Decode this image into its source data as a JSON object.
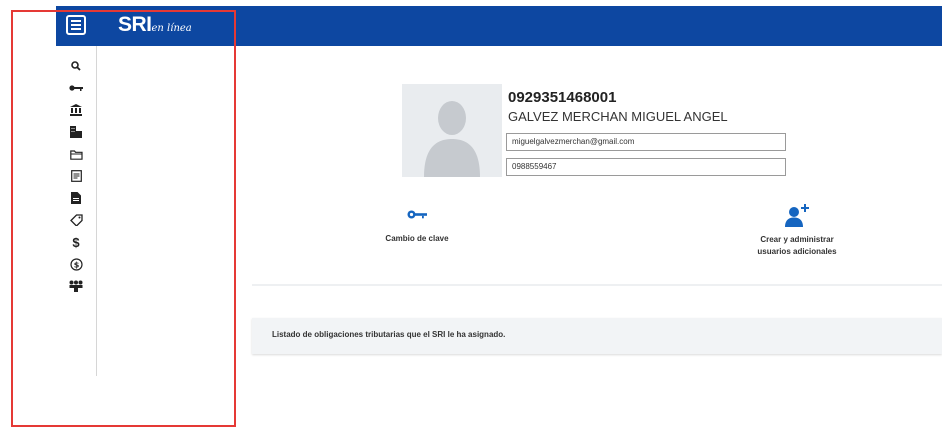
{
  "header": {
    "logo_main": "SRI",
    "logo_script": "en línea",
    "bg_color": "#0d47a1"
  },
  "sidebar": {
    "icons": [
      "search-icon",
      "key-icon",
      "bank-icon",
      "building-icon",
      "folder-icon",
      "document-list-icon",
      "document-icon",
      "tag-icon",
      "dollar-icon",
      "dollar-circle-icon",
      "group-icon"
    ],
    "dollar_glyph": "$"
  },
  "profile": {
    "id": "0929351468001",
    "name": "GALVEZ MERCHAN MIGUEL ANGEL",
    "email": "miguelgalvezmerchan@gmail.com",
    "phone": "0988559467"
  },
  "actions": {
    "change_password": "Cambio de clave",
    "manage_users_line1": "Crear y administrar",
    "manage_users_line2": "usuarios adicionales"
  },
  "obligations": {
    "text": "Listado de obligaciones tributarias que el SRI le ha asignado."
  },
  "annotation": {
    "color": "#e53935"
  }
}
